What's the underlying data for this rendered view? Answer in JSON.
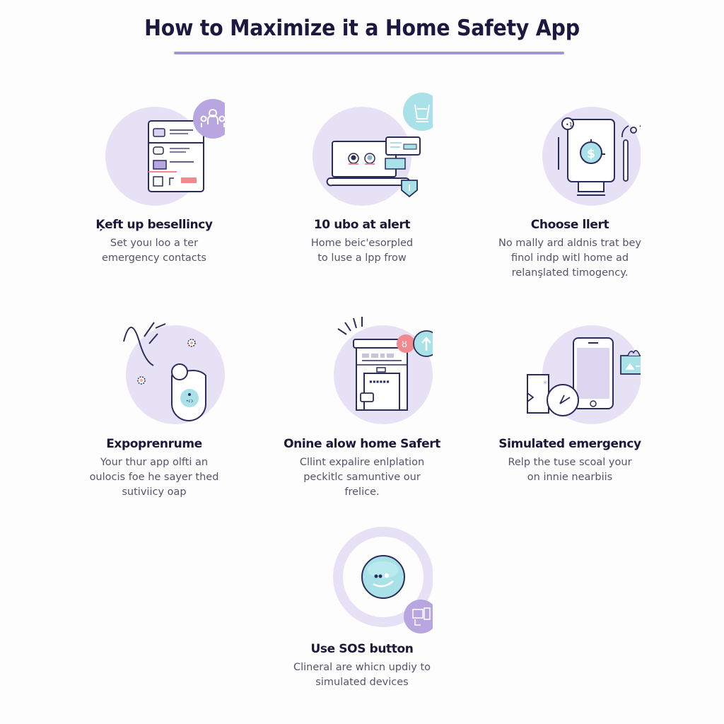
{
  "header": {
    "title": "How to Maximize it a Home Safety App"
  },
  "colors": {
    "title": "#1c1840",
    "accent_underline": "#a496d6",
    "icon_circle": "#e6e1f5",
    "badge_purple": "#b7a6e0",
    "badge_teal": "#a9e1e8",
    "alert_pink": "#f08a8e",
    "line": "#2a2d5c"
  },
  "steps": [
    {
      "icon": "contact-list-icon",
      "badge_icon": "people-group-icon",
      "heading": "Ķeft up besellincy",
      "description": "Set youı loo a ter emergency contacts"
    },
    {
      "icon": "laptop-alert-icon",
      "badge_icon": "basket-icon",
      "heading": "10 ubo at alert",
      "description": "Home beic'esorpled to luse a lpp frow"
    },
    {
      "icon": "safe-device-icon",
      "badge_icon": "wifi-signal-icon",
      "heading": "Choose llert",
      "description": "No mally ard aldnis trat bey finol indp witl home ad relanşlated timogency."
    },
    {
      "icon": "sensor-device-icon",
      "badge_icon": "motion-lines-icon",
      "heading": "Expoprenrume",
      "description": "Your thur app olfti an oulocis foe he sayer thed sutiviicy oap"
    },
    {
      "icon": "home-hub-icon",
      "badge_icon": "upload-arrow-icon",
      "heading": "Onine alow home Safert",
      "description": "Cllint expalire enlplation peckitlc samuntive our frelice."
    },
    {
      "icon": "smartphone-clock-icon",
      "badge_icon": "map-card-icon",
      "heading": "Simulated emergency",
      "description": "Relp the tuse scoal your on innie nearbiis"
    },
    {
      "icon": "sos-button-icon",
      "badge_icon": "devices-icon",
      "heading": "Use SOS button",
      "description": "Clineral are whicn updiy to simulated devices"
    }
  ]
}
